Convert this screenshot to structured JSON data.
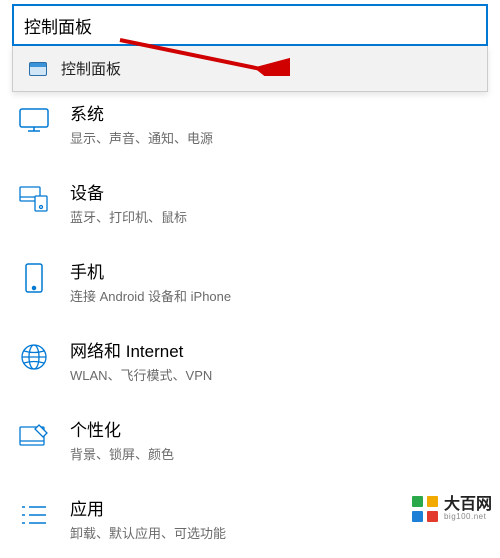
{
  "search": {
    "value": "控制面板",
    "suggestion": "控制面板"
  },
  "categories": [
    {
      "title": "系统",
      "sub": "显示、声音、通知、电源",
      "icon": "system"
    },
    {
      "title": "设备",
      "sub": "蓝牙、打印机、鼠标",
      "icon": "devices"
    },
    {
      "title": "手机",
      "sub": "连接 Android 设备和 iPhone",
      "icon": "phone"
    },
    {
      "title": "网络和 Internet",
      "sub": "WLAN、飞行模式、VPN",
      "icon": "network"
    },
    {
      "title": "个性化",
      "sub": "背景、锁屏、颜色",
      "icon": "personalization"
    },
    {
      "title": "应用",
      "sub": "卸载、默认应用、可选功能",
      "icon": "apps"
    }
  ],
  "watermark": {
    "brand": "大百网",
    "url": "big100.net"
  }
}
